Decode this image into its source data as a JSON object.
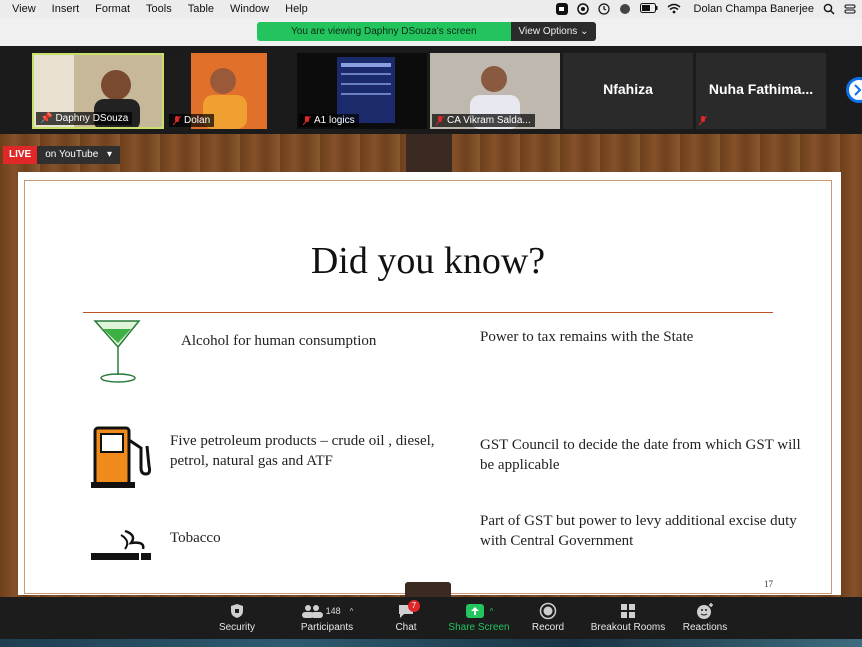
{
  "menubar": {
    "items": [
      "View",
      "Insert",
      "Format",
      "Tools",
      "Table",
      "Window",
      "Help"
    ],
    "user": "Dolan Champa Banerjee"
  },
  "banner": {
    "message": "You are viewing Daphny DSouza's screen",
    "options": "View Options"
  },
  "participants": [
    {
      "name": "Daphny DSouza"
    },
    {
      "name": "Dolan"
    },
    {
      "name": "A1 logics"
    },
    {
      "name": "CA Vikram Salda..."
    },
    {
      "name": "Nfahiza"
    },
    {
      "name": "Nuha Fathima..."
    }
  ],
  "live": {
    "tag": "LIVE",
    "platform": "on YouTube"
  },
  "slide": {
    "title": "Did you know?",
    "rows": [
      {
        "left": "Alcohol for human  consumption",
        "right": "Power to tax remains with the State"
      },
      {
        "left": "Five petroleum products – crude oil , diesel, petrol, natural gas and ATF",
        "right": "GST Council to decide the date from which GST will be applicable"
      },
      {
        "left": "Tobacco",
        "right": "Part of GST but power to levy additional excise duty with Central Government"
      }
    ],
    "page": "17"
  },
  "toolbar": {
    "security": "Security",
    "participants": "Participants",
    "participant_count": "148",
    "chat": "Chat",
    "chat_badge": "7",
    "share": "Share Screen",
    "record": "Record",
    "breakout": "Breakout Rooms",
    "reactions": "Reactions"
  },
  "colors": {
    "share_green": "#22c55e",
    "live_red": "#e02828",
    "banner_green": "#23c45e"
  }
}
